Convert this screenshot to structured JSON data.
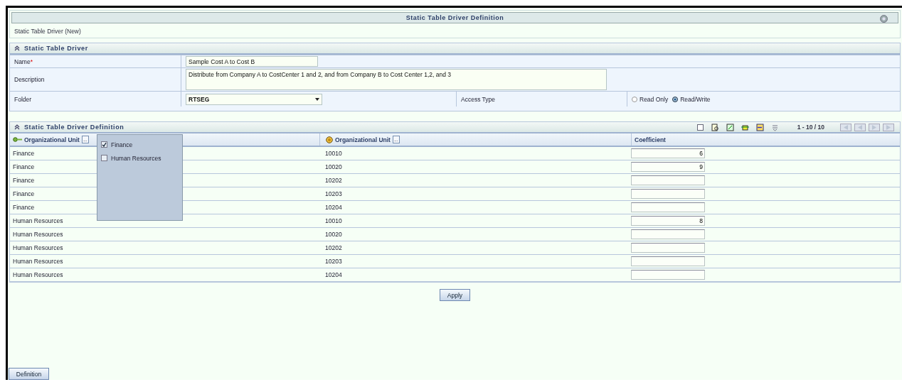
{
  "window": {
    "title": "Static Table Driver Definition",
    "subtitle": "Static Table Driver (New)"
  },
  "driver_section": {
    "title": "Static Table Driver",
    "expanded": true,
    "name": {
      "label": "Name",
      "required_mark": "*",
      "value": "Sample Cost A to Cost B"
    },
    "description": {
      "label": "Description",
      "value": "Distribute from Company A to CostCenter 1 and 2, and from Company B to Cost Center 1,2, and 3"
    },
    "folder": {
      "label": "Folder",
      "value": "RTSEG"
    },
    "access_type": {
      "label": "Access Type",
      "options": [
        {
          "label": "Read Only",
          "selected": false
        },
        {
          "label": "Read/Write",
          "selected": true
        }
      ]
    }
  },
  "definition_section": {
    "title": "Static Table Driver Definition",
    "expanded": true,
    "pagination": "1 - 10 / 10",
    "columns": [
      {
        "label": "Organizational Unit",
        "kind": "key",
        "menu": "..."
      },
      {
        "label": "Organizational Unit",
        "kind": "coin",
        "menu": "..."
      },
      {
        "label": "Coefficient",
        "kind": "plain"
      }
    ],
    "rows": [
      {
        "unit": "Finance",
        "org": "10010",
        "coefficient": "6"
      },
      {
        "unit": "Finance",
        "org": "10020",
        "coefficient": "9"
      },
      {
        "unit": "Finance",
        "org": "10202"
      },
      {
        "unit": "Finance",
        "org": "10203"
      },
      {
        "unit": "Finance",
        "org": "10204"
      },
      {
        "unit": "Human Resources",
        "org": "10010",
        "coefficient": "8"
      },
      {
        "unit": "Human Resources",
        "org": "10020"
      },
      {
        "unit": "Human Resources",
        "org": "10202"
      },
      {
        "unit": "Human Resources",
        "org": "10203"
      },
      {
        "unit": "Human Resources",
        "org": "10204"
      }
    ],
    "filter_menu": {
      "options": [
        {
          "label": "Finance",
          "checked": true
        },
        {
          "label": "Human Resources",
          "checked": false
        }
      ]
    }
  },
  "buttons": [
    {
      "label": "Apply",
      "kind": "apply"
    },
    {
      "label": "Definition",
      "kind": "tab"
    }
  ]
}
